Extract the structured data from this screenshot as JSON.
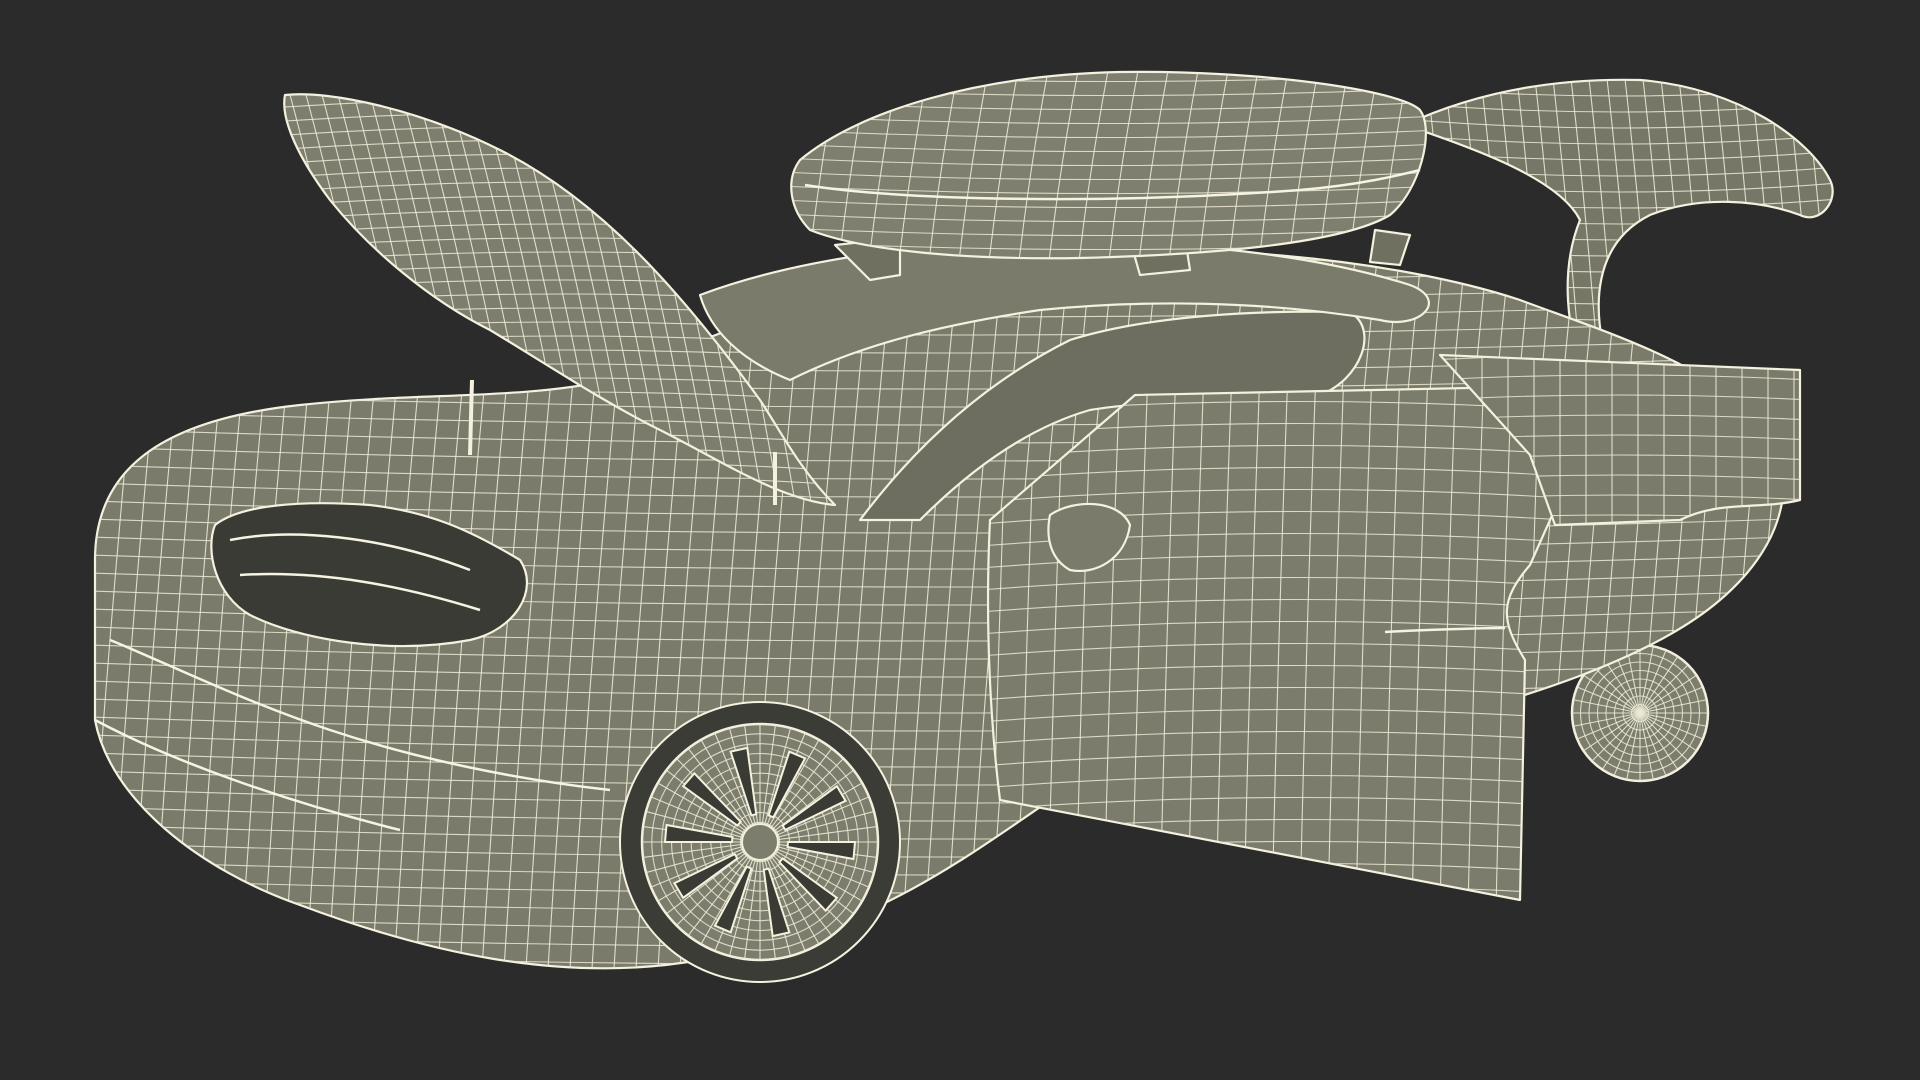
{
  "scene": {
    "subject": "car-wireframe-model",
    "colors": {
      "background": "#2b2b2b",
      "surface": "#7a7b6a",
      "surface_shadow": "#6d6e5f",
      "wire": "#ece9d6"
    }
  }
}
